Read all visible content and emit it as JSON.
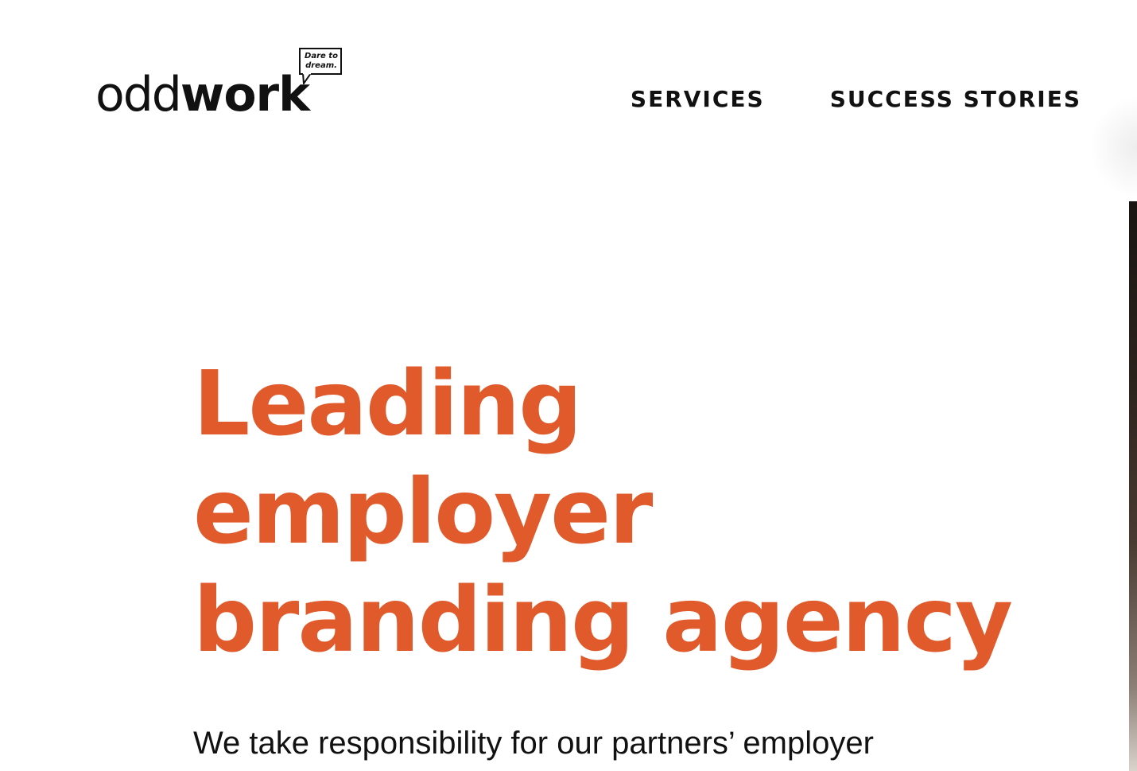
{
  "header": {
    "logo": {
      "text_light": "odd",
      "text_bold": "work",
      "tagline": "Dare to\ndream."
    },
    "nav": {
      "items": [
        {
          "label": "SERVICES"
        },
        {
          "label": "SUCCESS STORIES"
        }
      ]
    }
  },
  "hero": {
    "title_lines": [
      "Leading",
      "employer",
      "branding agency"
    ],
    "subtitle": "We take responsibility for our partners’ employer"
  },
  "colors": {
    "accent": "#e05a2b",
    "text": "#111111",
    "background": "#ffffff"
  }
}
